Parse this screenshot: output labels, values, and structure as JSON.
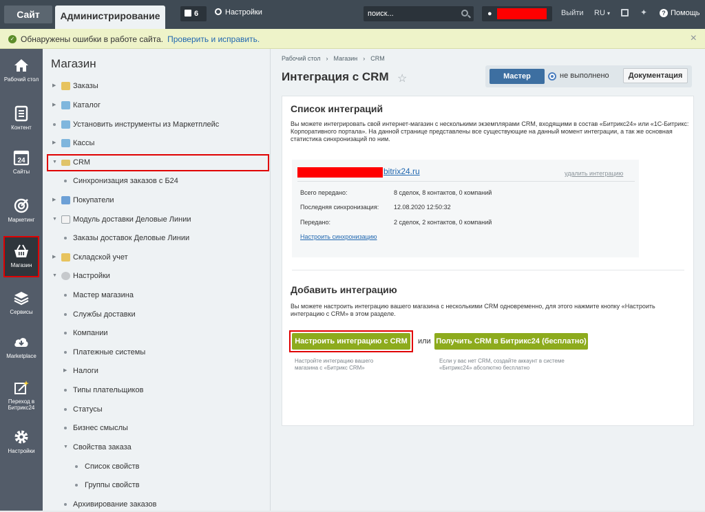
{
  "topbar": {
    "site_tab": "Сайт",
    "admin_tab": "Администрирование",
    "notifications_count": "6",
    "settings_label": "Настройки",
    "search_placeholder": "поиск...",
    "exit_label": "Выйти",
    "lang_label": "RU",
    "lang_chevron": "▾",
    "help_label": "Помощь",
    "help_glyph": "?"
  },
  "alert": {
    "text": "Обнаружены ошибки в работе сайта.",
    "link": "Проверить и исправить."
  },
  "leftnav": {
    "items": [
      {
        "label": "Рабочий стол",
        "icon": "home-icon"
      },
      {
        "label": "Контент",
        "icon": "document-icon"
      },
      {
        "label": "Сайты",
        "icon": "calendar-icon"
      },
      {
        "label": "Маркетинг",
        "icon": "target-icon"
      },
      {
        "label": "Магазин",
        "icon": "basket-icon"
      },
      {
        "label": "Сервисы",
        "icon": "layers-icon"
      },
      {
        "label": "Marketplace",
        "icon": "cloud-icon"
      },
      {
        "label": "Переход в Битрикс24",
        "icon": "magic-icon"
      },
      {
        "label": "Настройки",
        "icon": "gear-icon"
      }
    ],
    "calendar_day": "24"
  },
  "sidebar": {
    "title": "Магазин",
    "items": [
      {
        "label": "Заказы"
      },
      {
        "label": "Каталог"
      },
      {
        "label": "Установить инструменты из Маркетплейс"
      },
      {
        "label": "Кассы"
      },
      {
        "label": "CRM"
      },
      {
        "label": "Синхронизация заказов с Б24"
      },
      {
        "label": "Покупатели"
      },
      {
        "label": "Модуль доставки Деловые Линии"
      },
      {
        "label": "Заказы доставок Деловые Линии"
      },
      {
        "label": "Складской учет"
      },
      {
        "label": "Настройки"
      },
      {
        "label": "Мастер магазина"
      },
      {
        "label": "Службы доставки"
      },
      {
        "label": "Компании"
      },
      {
        "label": "Платежные системы"
      },
      {
        "label": "Налоги"
      },
      {
        "label": "Типы плательщиков"
      },
      {
        "label": "Статусы"
      },
      {
        "label": "Бизнес смыслы"
      },
      {
        "label": "Свойства заказа"
      },
      {
        "label": "Список свойств"
      },
      {
        "label": "Группы свойств"
      },
      {
        "label": "Архивирование заказов"
      }
    ]
  },
  "main": {
    "breadcrumb": [
      "Рабочий стол",
      "Магазин",
      "CRM"
    ],
    "breadcrumb_sep": "›",
    "title": "Интеграция с CRM",
    "wizard_label": "Мастер",
    "wizard_status": "не выполнено",
    "docs_label": "Документация",
    "list_title": "Список интеграций",
    "list_desc": "Вы можете интегрировать свой интернет-магазин с несколькими экземплярами CRM, входящими в состав «Битрикс24» или «1С-Битрикс: Корпоративного портала». На данной странице представлены все существующие на данный момент интеграции, а так же основная статистика синхронизаций по ним.",
    "integration": {
      "domain": "bitrix24.ru",
      "delete_label": "удалить интеграцию",
      "total_label": "Всего передано:",
      "total_value": "8 сделок, 8 контактов, 0 компаний",
      "last_sync_label": "Последняя синхронизация:",
      "last_sync_value": "12.08.2020 12:50:32",
      "sent_label": "Передано:",
      "sent_value": "2 сделок, 2 контактов, 0 компаний",
      "setup_sync_label": "Настроить синхронизацию"
    },
    "add_title": "Добавить интеграцию",
    "add_desc": "Вы можете настроить интеграцию вашего магазина с несколькими CRM одновременно, для этого нажмите кнопку «Настроить интеграцию с CRM» в этом разделе.",
    "setup_button": "Настроить интеграцию с CRM",
    "or_label": "или",
    "get_button": "Получить CRM в Битрикс24 (бесплатно)",
    "setup_hint": "Настройте интеграцию вашего магазина с «Битрикс CRM»",
    "get_hint": "Если у вас нет CRM, создайте аккаунт в системе «Битрикс24» абсолютно бесплатно"
  },
  "colors": {
    "topbar": "#3f4a54",
    "leftnav": "#535c69",
    "accent_blue": "#2067b0",
    "button_green": "#8dab1d",
    "highlight_red": "#e00000"
  }
}
